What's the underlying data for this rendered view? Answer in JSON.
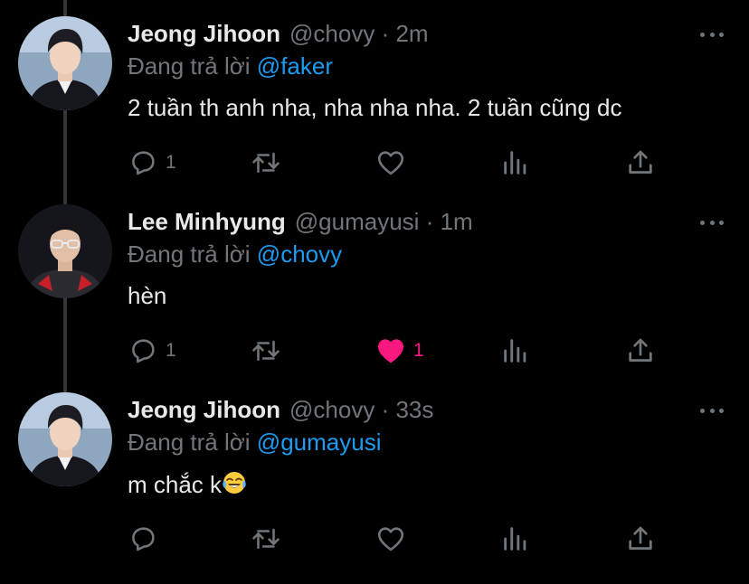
{
  "tweets": [
    {
      "name": "Jeong Jihoon",
      "handle": "@chovy",
      "separator": "·",
      "time": "2m",
      "reply_prefix": "Đang trả lời",
      "reply_to": "@faker",
      "text": "2 tuần th anh nha, nha nha nha. 2 tuần cũng dc",
      "reply_count": "1",
      "retweet_count": "",
      "like_count": "",
      "liked": false
    },
    {
      "name": "Lee Minhyung",
      "handle": "@gumayusi",
      "separator": "·",
      "time": "1m",
      "reply_prefix": "Đang trả lời",
      "reply_to": "@chovy",
      "text": "hèn",
      "reply_count": "1",
      "retweet_count": "",
      "like_count": "1",
      "liked": true
    },
    {
      "name": "Jeong Jihoon",
      "handle": "@chovy",
      "separator": "·",
      "time": "33s",
      "reply_prefix": "Đang trả lời",
      "reply_to": "@gumayusi",
      "text": "m chắc k",
      "text_emoji": "face-with-tears-of-joy",
      "reply_count": "",
      "retweet_count": "",
      "like_count": "",
      "liked": false
    }
  ],
  "colors": {
    "background": "#000000",
    "text": "#e7e9ea",
    "muted": "#71767b",
    "mention": "#1d9bf0",
    "like": "#f91880",
    "thread_line": "#333639"
  },
  "icons": [
    "reply-icon",
    "retweet-icon",
    "like-icon",
    "analytics-icon",
    "share-icon",
    "more-icon"
  ]
}
